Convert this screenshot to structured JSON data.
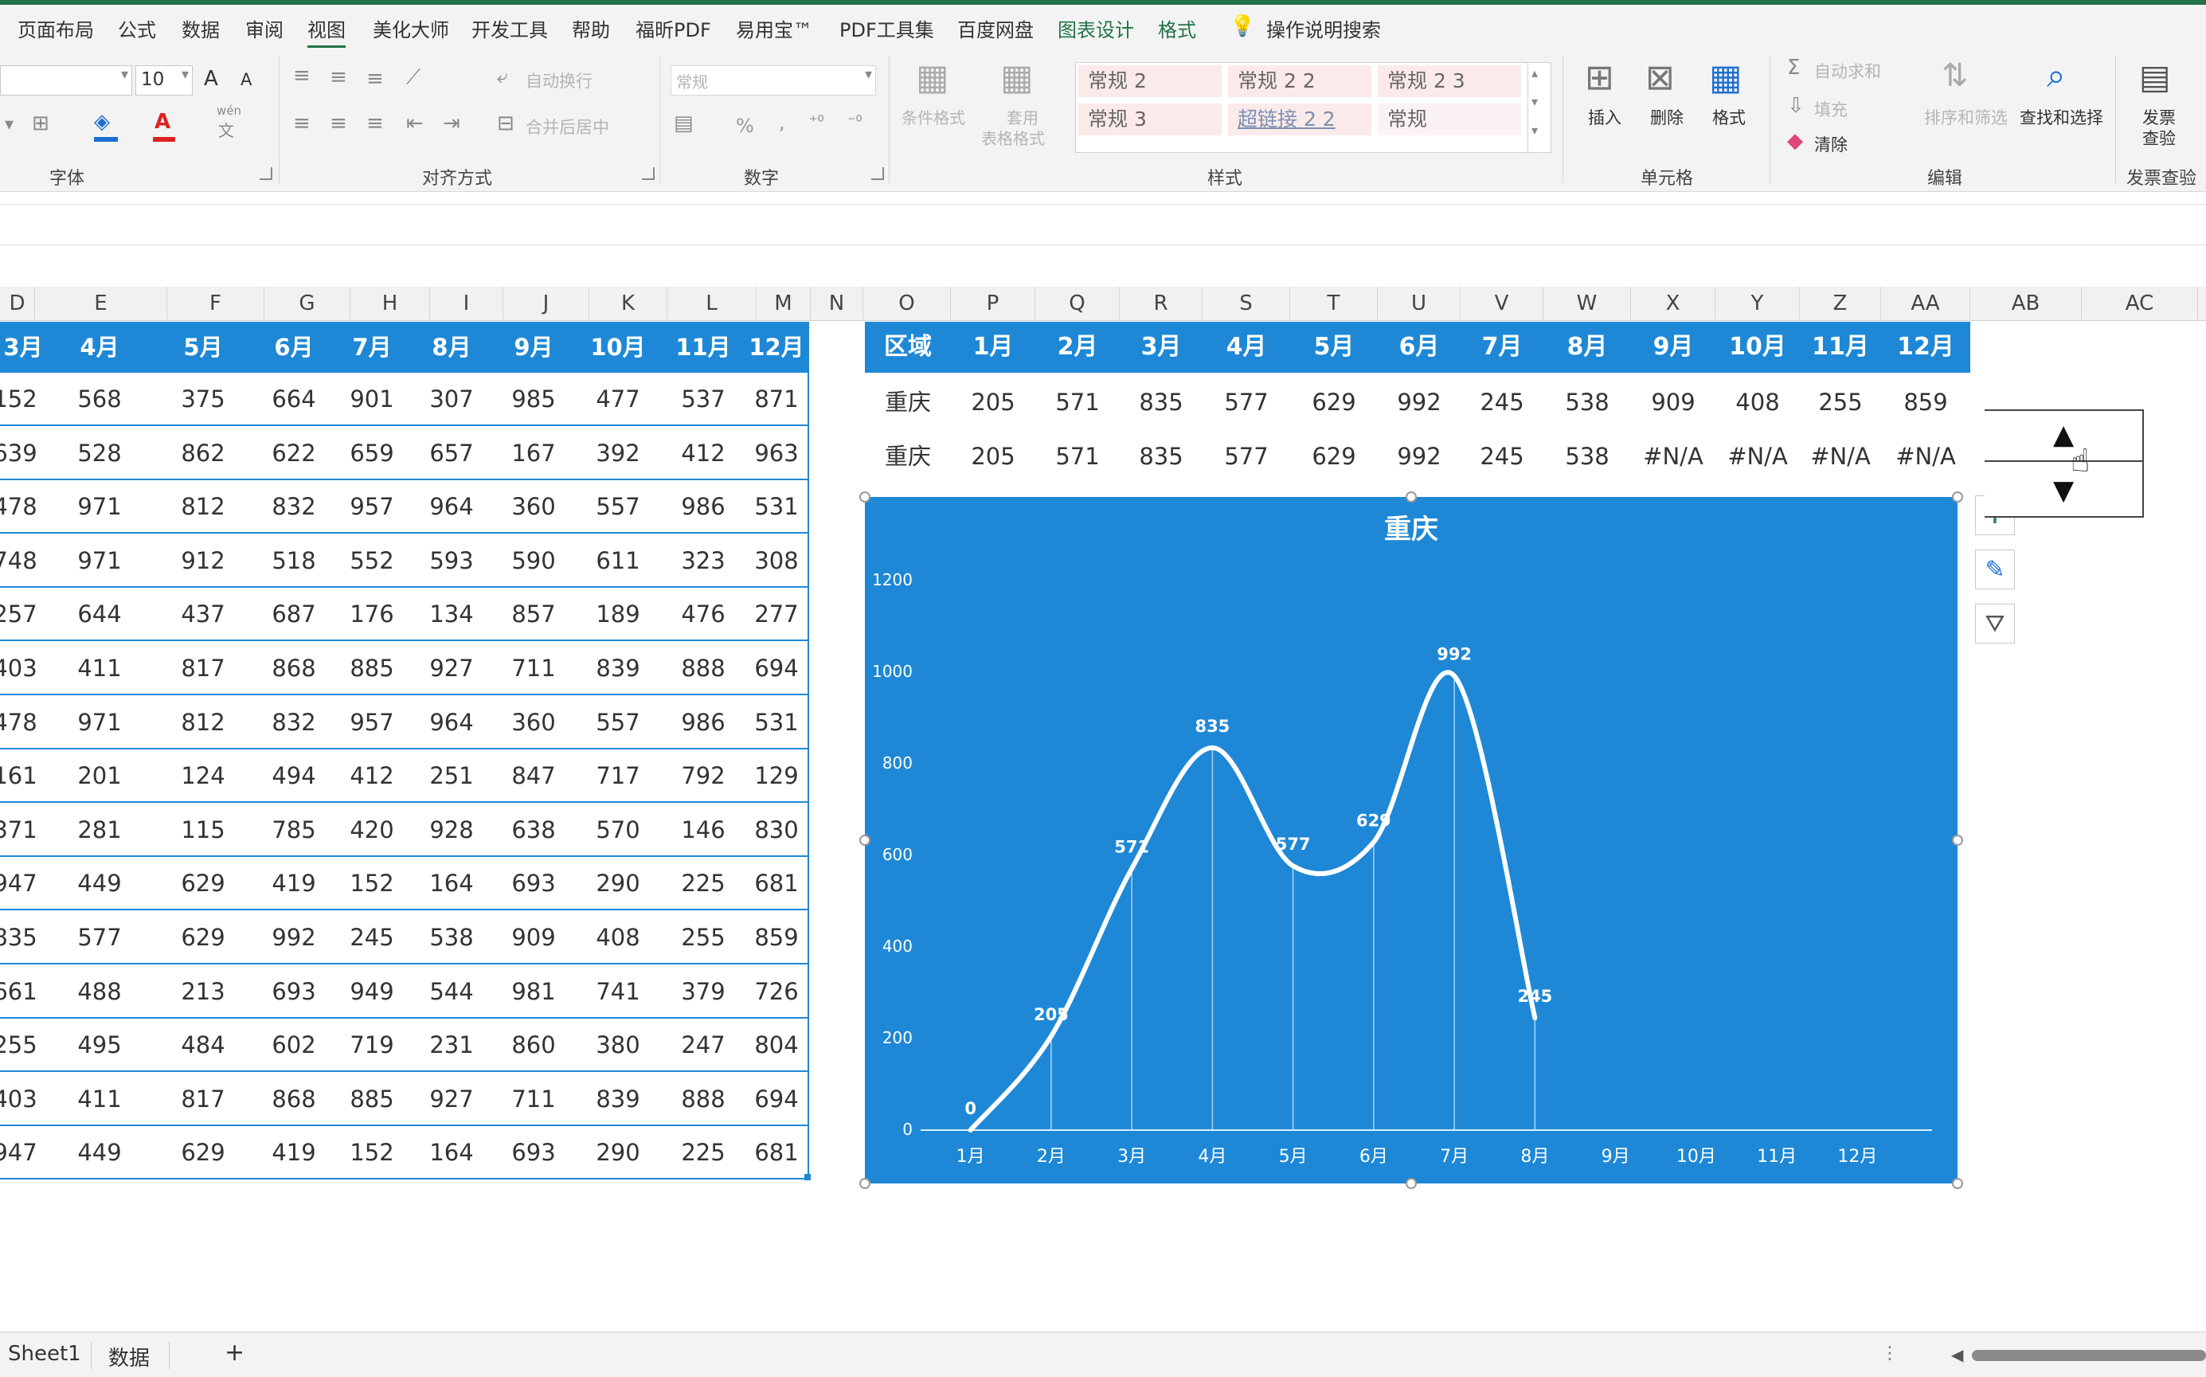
{
  "menu": {
    "tabs": [
      "页面布局",
      "公式",
      "数据",
      "审阅",
      "视图",
      "美化大师",
      "开发工具",
      "帮助",
      "福昕PDF",
      "易用宝™",
      "PDF工具集",
      "百度网盘",
      "图表设计",
      "格式"
    ],
    "active": "视图",
    "search_label": "操作说明搜索"
  },
  "ribbon": {
    "font": {
      "label": "字体",
      "size": "10",
      "grow": "A",
      "shrink": "A",
      "wen": "wén",
      "wen_char": "文"
    },
    "align": {
      "label": "对齐方式",
      "wrap": "自动换行",
      "merge": "合并后居中"
    },
    "number": {
      "label": "数字",
      "format": "常规",
      "percent": "%",
      "comma": ","
    },
    "styles": {
      "label": "样式",
      "cond": "条件格式",
      "table1": "套用",
      "table2": "表格格式",
      "cells": [
        "常规 2",
        "常规 2 2",
        "常规 2 3",
        "常规 3",
        "超链接 2 2",
        "常规"
      ]
    },
    "cells": {
      "label": "单元格",
      "insert": "插入",
      "delete": "删除",
      "format": "格式"
    },
    "edit": {
      "label": "编辑",
      "autosum": "自动求和",
      "fill": "填充",
      "clear": "清除",
      "sort": "排序和筛选",
      "find": "查找和选择"
    },
    "invoice": {
      "label": "发票查验",
      "btn1": "发票",
      "btn2": "查验"
    }
  },
  "columns": [
    "D",
    "E",
    "F",
    "G",
    "H",
    "I",
    "J",
    "K",
    "L",
    "M",
    "N",
    "O",
    "P",
    "Q",
    "R",
    "S",
    "T",
    "U",
    "V",
    "W",
    "X",
    "Y",
    "Z",
    "AA",
    "AB",
    "AC"
  ],
  "left_table": {
    "headers": [
      "3月",
      "4月",
      "5月",
      "6月",
      "7月",
      "8月",
      "9月",
      "10月",
      "11月",
      "12月"
    ],
    "rows": [
      [
        "152",
        "568",
        "375",
        "664",
        "901",
        "307",
        "985",
        "477",
        "537",
        "871"
      ],
      [
        "639",
        "528",
        "862",
        "622",
        "659",
        "657",
        "167",
        "392",
        "412",
        "963"
      ],
      [
        "478",
        "971",
        "812",
        "832",
        "957",
        "964",
        "360",
        "557",
        "986",
        "531"
      ],
      [
        "748",
        "971",
        "912",
        "518",
        "552",
        "593",
        "590",
        "611",
        "323",
        "308"
      ],
      [
        "257",
        "644",
        "437",
        "687",
        "176",
        "134",
        "857",
        "189",
        "476",
        "277"
      ],
      [
        "403",
        "411",
        "817",
        "868",
        "885",
        "927",
        "711",
        "839",
        "888",
        "694"
      ],
      [
        "478",
        "971",
        "812",
        "832",
        "957",
        "964",
        "360",
        "557",
        "986",
        "531"
      ],
      [
        "161",
        "201",
        "124",
        "494",
        "412",
        "251",
        "847",
        "717",
        "792",
        "129"
      ],
      [
        "371",
        "281",
        "115",
        "785",
        "420",
        "928",
        "638",
        "570",
        "146",
        "830"
      ],
      [
        "947",
        "449",
        "629",
        "419",
        "152",
        "164",
        "693",
        "290",
        "225",
        "681"
      ],
      [
        "835",
        "577",
        "629",
        "992",
        "245",
        "538",
        "909",
        "408",
        "255",
        "859"
      ],
      [
        "661",
        "488",
        "213",
        "693",
        "949",
        "544",
        "981",
        "741",
        "379",
        "726"
      ],
      [
        "255",
        "495",
        "484",
        "602",
        "719",
        "231",
        "860",
        "380",
        "247",
        "804"
      ],
      [
        "403",
        "411",
        "817",
        "868",
        "885",
        "927",
        "711",
        "839",
        "888",
        "694"
      ],
      [
        "947",
        "449",
        "629",
        "419",
        "152",
        "164",
        "693",
        "290",
        "225",
        "681"
      ]
    ]
  },
  "right_table": {
    "headers": [
      "区域",
      "1月",
      "2月",
      "3月",
      "4月",
      "5月",
      "6月",
      "7月",
      "8月",
      "9月",
      "10月",
      "11月",
      "12月"
    ],
    "rows": [
      [
        "重庆",
        "205",
        "571",
        "835",
        "577",
        "629",
        "992",
        "245",
        "538",
        "909",
        "408",
        "255",
        "859"
      ],
      [
        "重庆",
        "205",
        "571",
        "835",
        "577",
        "629",
        "992",
        "245",
        "538",
        "#N/A",
        "#N/A",
        "#N/A",
        "#N/A"
      ]
    ]
  },
  "chart_data": {
    "type": "line",
    "title": "重庆",
    "categories": [
      "1月",
      "2月",
      "3月",
      "4月",
      "5月",
      "6月",
      "7月",
      "8月",
      "9月",
      "10月",
      "11月",
      "12月"
    ],
    "series": [
      {
        "values": [
          0,
          205,
          571,
          835,
          577,
          629,
          992,
          245,
          null,
          null,
          null,
          null
        ]
      }
    ],
    "data_labels": [
      "0",
      "205",
      "571",
      "835",
      "577",
      "629",
      "992",
      "245"
    ],
    "yticks": [
      "0",
      "200",
      "400",
      "600",
      "800",
      "1000",
      "1200"
    ],
    "ylim": [
      0,
      1200
    ],
    "smooth": true,
    "drop_lines": true,
    "background": "#1e88d6",
    "line_color": "#ffffff"
  },
  "chart_side": {
    "add": "+",
    "style": "brush",
    "filter": "filter"
  },
  "sheets": {
    "tabs": [
      "Sheet1",
      "数据"
    ],
    "add": "+"
  },
  "colors": {
    "header_blue": "#1e88d6",
    "excel_green": "#217346"
  }
}
